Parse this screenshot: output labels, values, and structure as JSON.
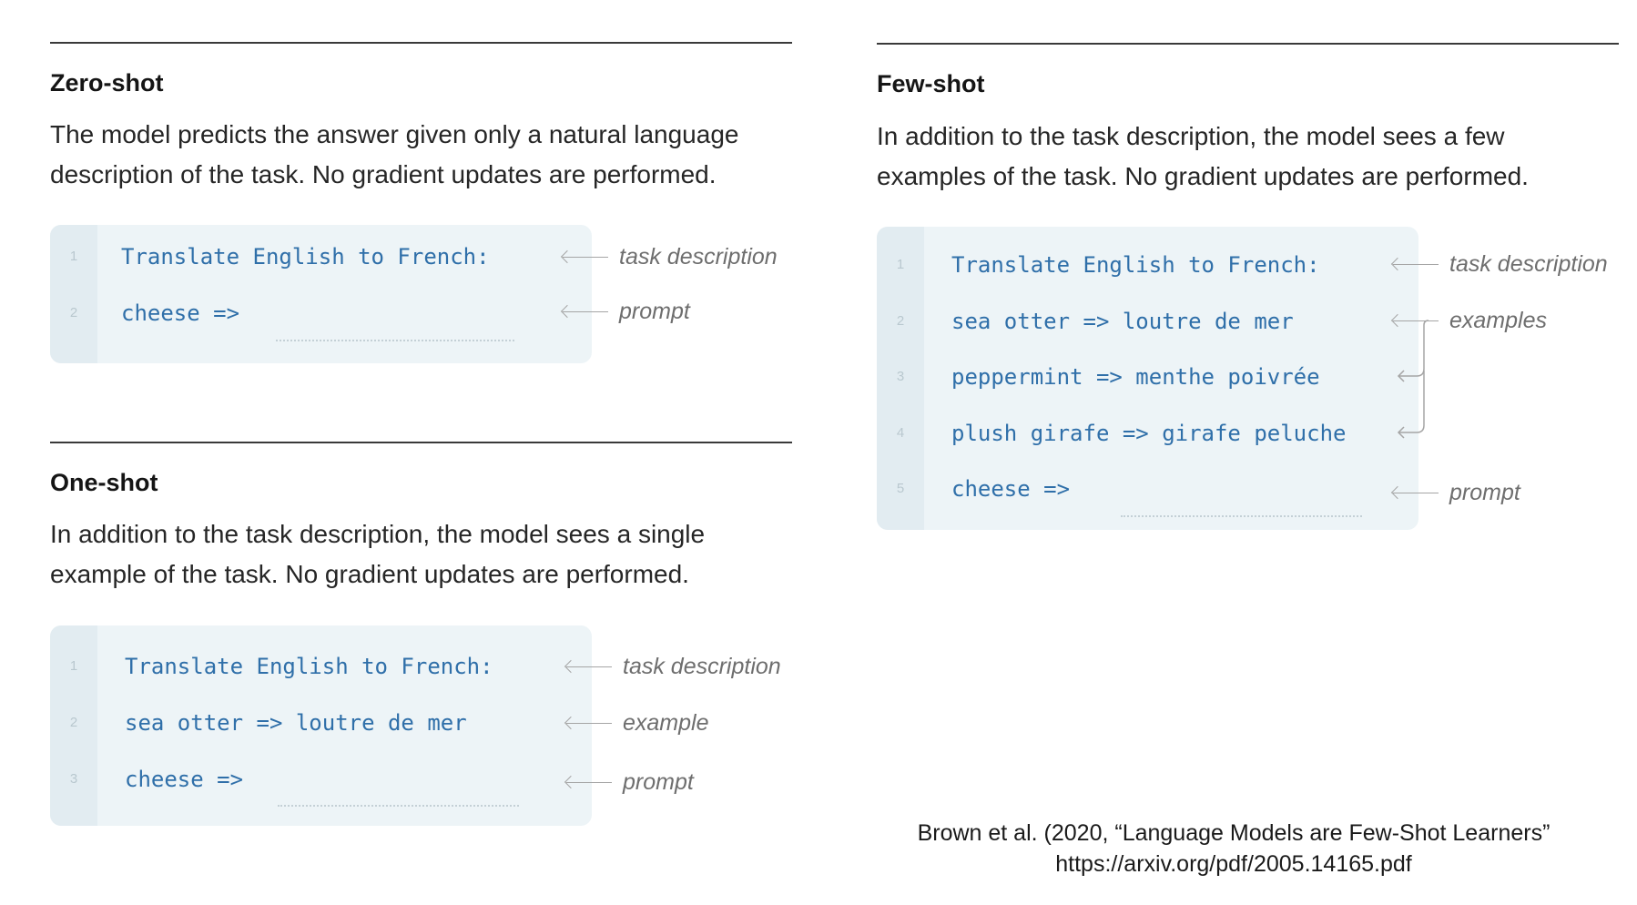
{
  "zero_shot": {
    "title": "Zero-shot",
    "description_lines": [
      "The model predicts the answer given only a natural language",
      "description of the task. No gradient updates are performed."
    ],
    "lines": [
      {
        "num": "1",
        "code": "Translate English to French:"
      },
      {
        "num": "2",
        "code": "cheese =>"
      }
    ],
    "annotations": [
      "task description",
      "prompt"
    ]
  },
  "one_shot": {
    "title": "One-shot",
    "description_lines": [
      "In addition to the task description, the model sees a single",
      "example of the task. No gradient updates are performed."
    ],
    "lines": [
      {
        "num": "1",
        "code": "Translate English to French:"
      },
      {
        "num": "2",
        "code": "sea otter => loutre de mer"
      },
      {
        "num": "3",
        "code": "cheese =>"
      }
    ],
    "annotations": [
      "task description",
      "example",
      "prompt"
    ]
  },
  "few_shot": {
    "title": "Few-shot",
    "description_lines": [
      "In addition to the task description, the model sees a few",
      "examples of the task. No gradient updates are performed."
    ],
    "lines": [
      {
        "num": "1",
        "code": "Translate English to French:"
      },
      {
        "num": "2",
        "code": "sea otter => loutre de mer"
      },
      {
        "num": "3",
        "code": "peppermint => menthe poivrée"
      },
      {
        "num": "4",
        "code": "plush girafe => girafe peluche"
      },
      {
        "num": "5",
        "code": "cheese =>"
      }
    ],
    "annotations": [
      "task description",
      "examples",
      "prompt"
    ]
  },
  "citation": {
    "line1": "Brown et al. (2020, “Language Models are Few-Shot Learners”",
    "line2": "https://arxiv.org/pdf/2005.14165.pdf"
  },
  "colors": {
    "code_text": "#2f6fa9",
    "code_bg": "#edf4f7",
    "gutter_bg": "#e2ecf1",
    "annotation": "#6e6e6e"
  }
}
